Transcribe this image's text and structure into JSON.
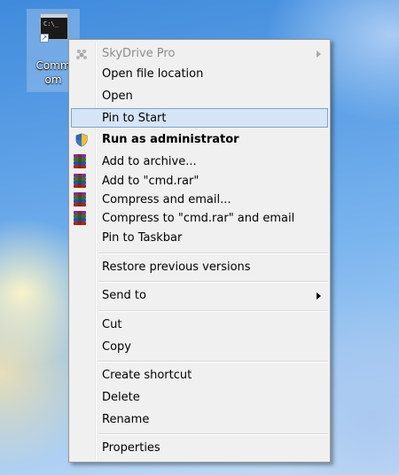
{
  "desktop_icon": {
    "label": "Command Prompt",
    "label_line1": "Comm",
    "label_line2": "om",
    "thumb_text": "C:\\_"
  },
  "menu": {
    "items": [
      {
        "label": "SkyDrive Pro",
        "state": "disabled",
        "icon": "skydrive-icon",
        "submenu": true
      },
      {
        "label": "Open file location"
      },
      {
        "label": "Open"
      },
      {
        "label": "Pin to Start",
        "state": "highlighted"
      },
      {
        "label": "Run as administrator",
        "bold": true,
        "icon": "uac-shield-icon"
      },
      {
        "label": "Add to archive...",
        "icon": "winrar-icon"
      },
      {
        "label": "Add to \"cmd.rar\"",
        "icon": "winrar-icon"
      },
      {
        "label": "Compress and email...",
        "icon": "winrar-icon"
      },
      {
        "label": "Compress to \"cmd.rar\" and email",
        "icon": "winrar-icon"
      },
      {
        "label": "Pin to Taskbar"
      },
      {
        "label": "Restore previous versions"
      },
      {
        "label": "Send to",
        "submenu": true
      },
      {
        "label": "Cut"
      },
      {
        "label": "Copy"
      },
      {
        "label": "Create shortcut"
      },
      {
        "label": "Delete"
      },
      {
        "label": "Rename"
      },
      {
        "label": "Properties"
      }
    ]
  },
  "colors": {
    "highlight_bg": "#d5e4f6",
    "highlight_border": "#7da2ce",
    "disabled_text": "#8d8d8d"
  }
}
